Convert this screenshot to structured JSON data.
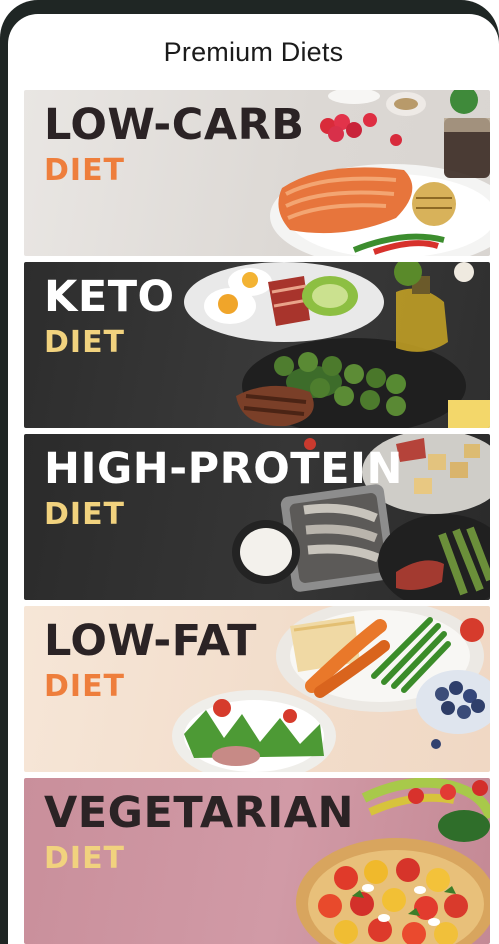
{
  "header": {
    "title": "Premium Diets"
  },
  "diets": [
    {
      "title": "LOW-CARB",
      "subtitle": "DIET"
    },
    {
      "title": "KETO",
      "subtitle": "DIET"
    },
    {
      "title": "HIGH-PROTEIN",
      "subtitle": "DIET"
    },
    {
      "title": "LOW-FAT",
      "subtitle": "DIET"
    },
    {
      "title": "VEGETARIAN",
      "subtitle": "DIET"
    }
  ],
  "colors": {
    "accent_orange": "#ee7e3c",
    "accent_yellow": "#f1d27e",
    "dark_text": "#2b2325"
  }
}
